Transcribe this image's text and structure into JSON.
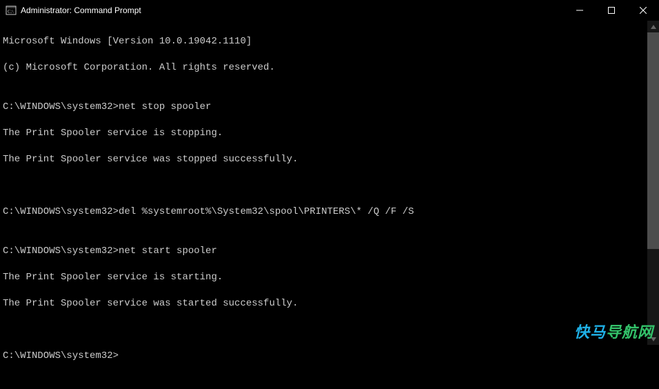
{
  "window": {
    "title": "Administrator: Command Prompt"
  },
  "terminal": {
    "banner1": "Microsoft Windows [Version 10.0.19042.1110]",
    "banner2": "(c) Microsoft Corporation. All rights reserved.",
    "blank": "",
    "prompt": "C:\\WINDOWS\\system32>",
    "cmd1": "net stop spooler",
    "out1a": "The Print Spooler service is stopping.",
    "out1b": "The Print Spooler service was stopped successfully.",
    "cmd2": "del %systemroot%\\System32\\spool\\PRINTERS\\* /Q /F /S",
    "cmd3": "net start spooler",
    "out3a": "The Print Spooler service is starting.",
    "out3b": "The Print Spooler service was started successfully."
  },
  "watermark": {
    "part1": "快马",
    "part2": "导航网"
  }
}
